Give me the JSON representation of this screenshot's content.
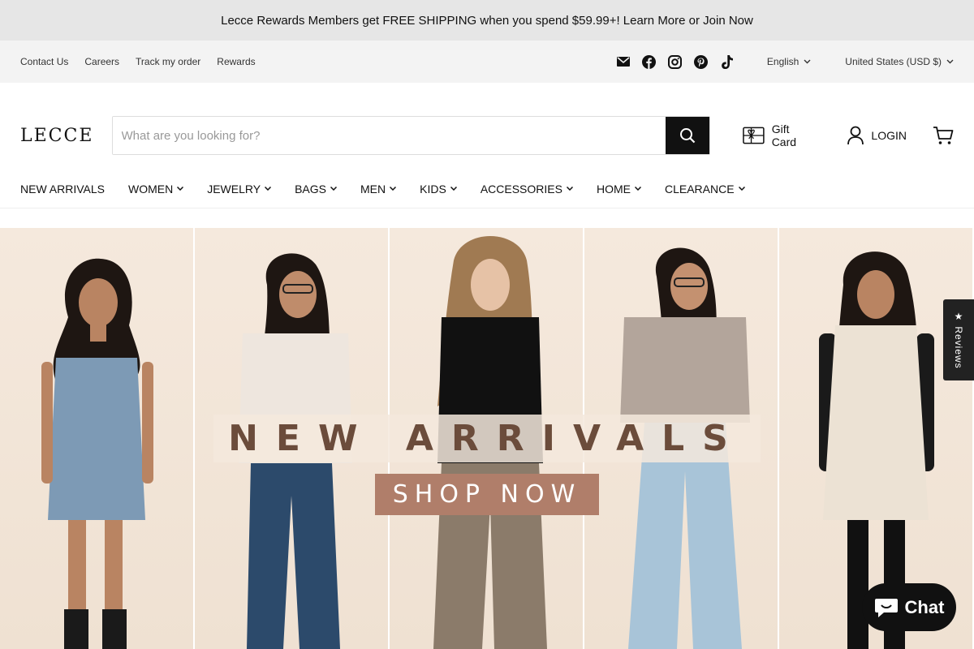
{
  "announcement": "Lecce Rewards Members get FREE SHIPPING when you spend $59.99+! Learn More or Join Now",
  "utility": {
    "links": [
      "Contact Us",
      "Careers",
      "Track my order",
      "Rewards"
    ],
    "social_icons": [
      "email-icon",
      "facebook-icon",
      "instagram-icon",
      "pinterest-icon",
      "tiktok-icon"
    ],
    "language": "English",
    "currency": "United States (USD $)"
  },
  "header": {
    "logo": "LECCE",
    "search_placeholder": "What are you looking for?",
    "search_value": "",
    "gift_card": "Gift Card",
    "login": "LOGIN"
  },
  "nav": {
    "items": [
      {
        "label": "NEW ARRIVALS",
        "dropdown": false
      },
      {
        "label": "WOMEN",
        "dropdown": true
      },
      {
        "label": "JEWELRY",
        "dropdown": true
      },
      {
        "label": "BAGS",
        "dropdown": true
      },
      {
        "label": "MEN",
        "dropdown": true
      },
      {
        "label": "KIDS",
        "dropdown": true
      },
      {
        "label": "ACCESSORIES",
        "dropdown": true
      },
      {
        "label": "HOME",
        "dropdown": true
      },
      {
        "label": "CLEARANCE",
        "dropdown": true
      }
    ]
  },
  "hero": {
    "title": "NEW ARRIVALS",
    "button": "SHOP NOW"
  },
  "reviews_tab": "★ Reviews",
  "chat": "Chat",
  "colors": {
    "announce_bg": "#e6e6e6",
    "utility_bg": "#f3f3f3",
    "hero_bg": "#f5e9dd",
    "hero_title": "#6b4c3b",
    "hero_button": "#b07e6a"
  }
}
